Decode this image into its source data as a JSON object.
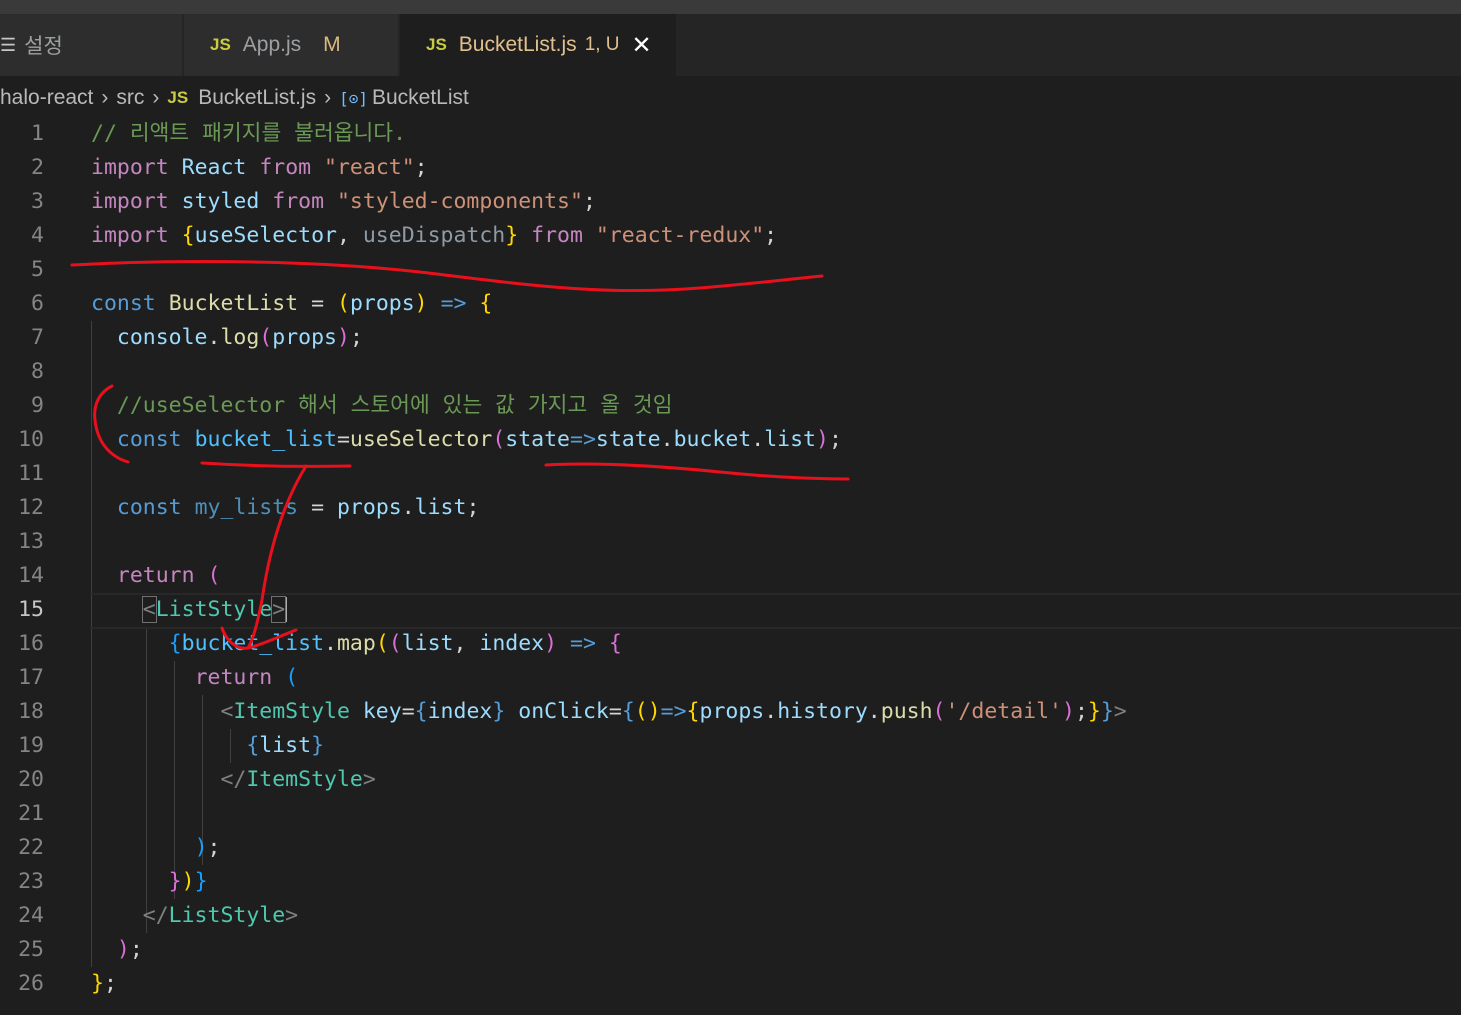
{
  "tabs": [
    {
      "label": "설정",
      "icon": "settings-list-icon"
    },
    {
      "label": "App.js",
      "badge": "M",
      "icon": "js-file-icon"
    },
    {
      "label": "BucketList.js",
      "status": "1, U",
      "icon": "js-file-icon",
      "active": true
    }
  ],
  "js_badge": "JS",
  "breadcrumb": {
    "project": "halo-react",
    "folder": "src",
    "file": "BucketList.js",
    "symbol": "BucketList"
  },
  "line_numbers": [
    "1",
    "2",
    "3",
    "4",
    "5",
    "6",
    "7",
    "8",
    "9",
    "10",
    "11",
    "12",
    "13",
    "14",
    "15",
    "16",
    "17",
    "18",
    "19",
    "20",
    "21",
    "22",
    "23",
    "24",
    "25",
    "26"
  ],
  "code": {
    "l1_comment": "// 리액트 패키지를 불러옵니다.",
    "kw_import": "import",
    "kw_from": "from",
    "l2_name": "React",
    "l2_str": "\"react\"",
    "l3_name": "styled",
    "l3_str": "\"styled-components\"",
    "l4_use_selector": "useSelector",
    "l4_use_dispatch": "useDispatch",
    "l4_str": "\"react-redux\"",
    "kw_const": "const",
    "l6_name": "BucketList",
    "props": "props",
    "l7_console": "console",
    "l7_log": "log",
    "l9_comment": "//useSelector 해서 스토어에 있는 값 가지고 올 것임",
    "bucket_list": "bucket_list",
    "state": "state",
    "bucket": "bucket",
    "list": "list",
    "my_lists": "my_lists",
    "kw_return": "return",
    "list_style": "ListStyle",
    "map": "map",
    "index": "index",
    "item_style": "ItemStyle",
    "attr_key": "key",
    "attr_onclick": "onClick",
    "history": "history",
    "push": "push",
    "detail_str": "'/detail'"
  },
  "colors": {
    "annotation": "#e8101c",
    "editor_bg": "#1e1e1e"
  }
}
